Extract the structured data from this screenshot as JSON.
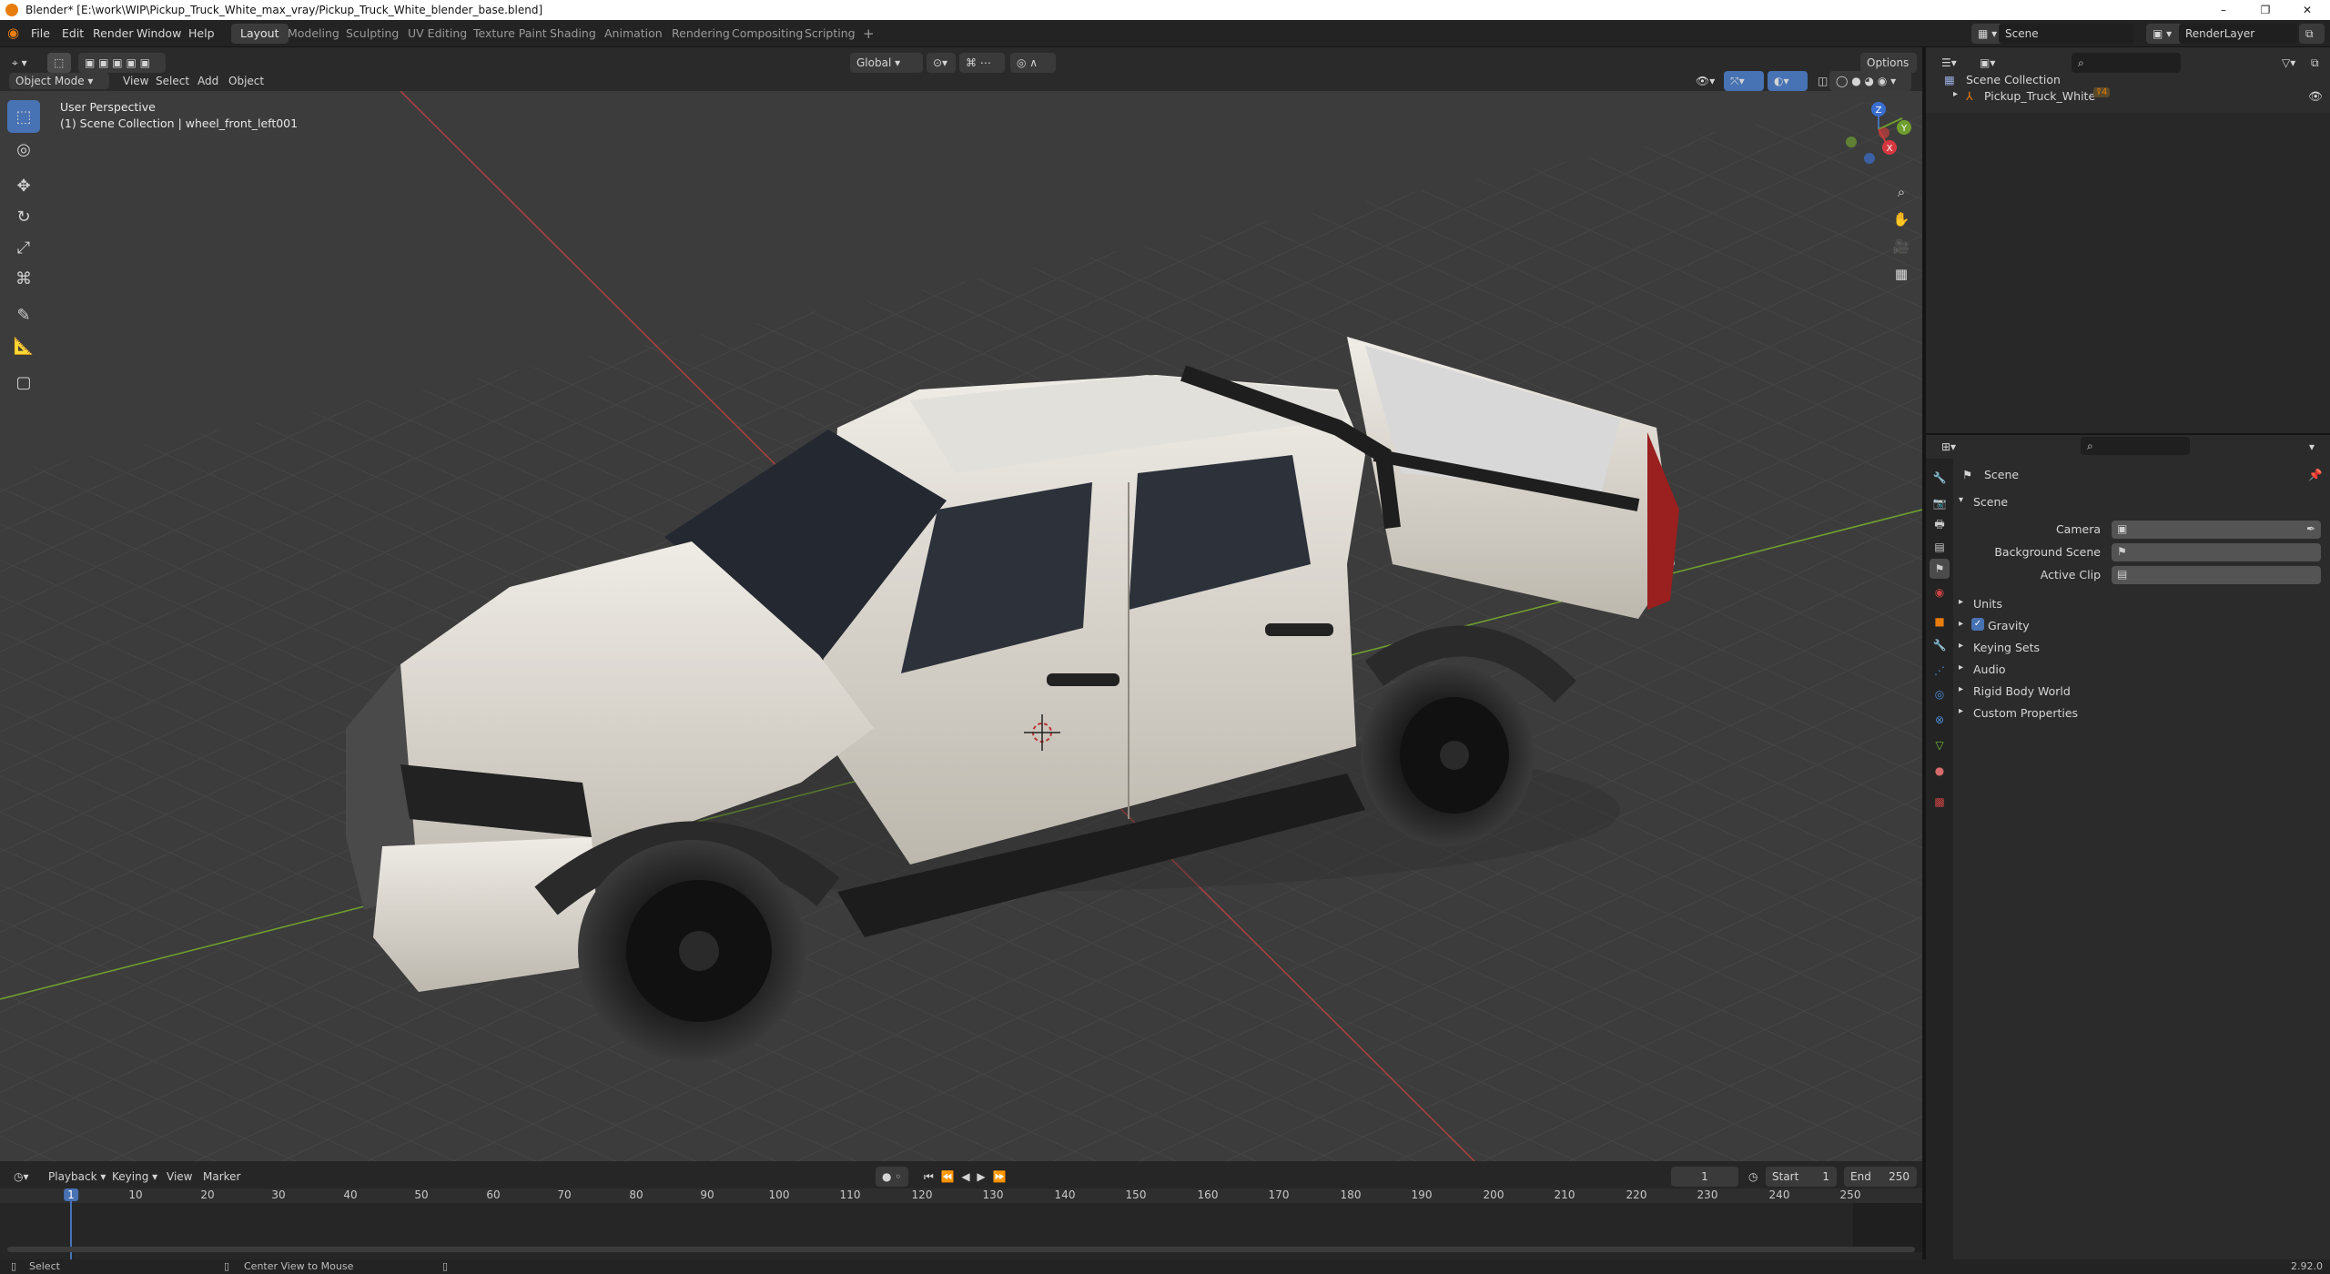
{
  "window": {
    "title": "Blender* [E:\\work\\WIP\\Pickup_Truck_White_max_vray/Pickup_Truck_White_blender_base.blend]",
    "minimize": "–",
    "restore": "❐",
    "close": "✕"
  },
  "menu": [
    "File",
    "Edit",
    "Render",
    "Window",
    "Help"
  ],
  "workspaces": [
    "Layout",
    "Modeling",
    "Sculpting",
    "UV Editing",
    "Texture Paint",
    "Shading",
    "Animation",
    "Rendering",
    "Compositing",
    "Scripting"
  ],
  "workspace_add": "+",
  "scene_selector": {
    "scene": "Scene",
    "render_layer": "RenderLayer"
  },
  "viewport_header": {
    "mode": "Object Mode",
    "menus": [
      "View",
      "Select",
      "Add",
      "Object"
    ],
    "orientation": "Global",
    "options": "Options"
  },
  "viewport": {
    "perspective_label": "User Perspective",
    "collection_label": "(1) Scene Collection | wheel_front_left001",
    "gizmo": {
      "x": "X",
      "y": "Y",
      "z": "Z"
    }
  },
  "outliner": {
    "root": "Scene Collection",
    "items": [
      {
        "label": "Pickup_Truck_White"
      }
    ]
  },
  "properties": {
    "context": "Scene",
    "panel_title": "Scene",
    "fields": [
      {
        "label": "Camera",
        "value": ""
      },
      {
        "label": "Background Scene",
        "value": ""
      },
      {
        "label": "Active Clip",
        "value": ""
      }
    ],
    "subpanels": [
      "Units",
      "Gravity",
      "Keying Sets",
      "Audio",
      "Rigid Body World",
      "Custom Properties"
    ],
    "gravity_checked": true
  },
  "timeline": {
    "menus": [
      "Playback",
      "Keying",
      "View",
      "Marker"
    ],
    "current_frame": "1",
    "start_label": "Start",
    "start": "1",
    "end_label": "End",
    "end": "250",
    "ruler": [
      "1",
      "10",
      "20",
      "30",
      "40",
      "50",
      "60",
      "70",
      "80",
      "90",
      "100",
      "110",
      "120",
      "130",
      "140",
      "150",
      "160",
      "170",
      "180",
      "190",
      "200",
      "210",
      "220",
      "230",
      "240",
      "250"
    ]
  },
  "statusbar": {
    "select": "Select",
    "center": "Center View to Mouse",
    "version": "2.92.0"
  },
  "colors": {
    "accent": "#4772b3",
    "orange": "#e87d0d",
    "x_axis": "#c43c3c",
    "y_axis": "#6f9e2f",
    "truck_body": "#d9d5cc"
  }
}
